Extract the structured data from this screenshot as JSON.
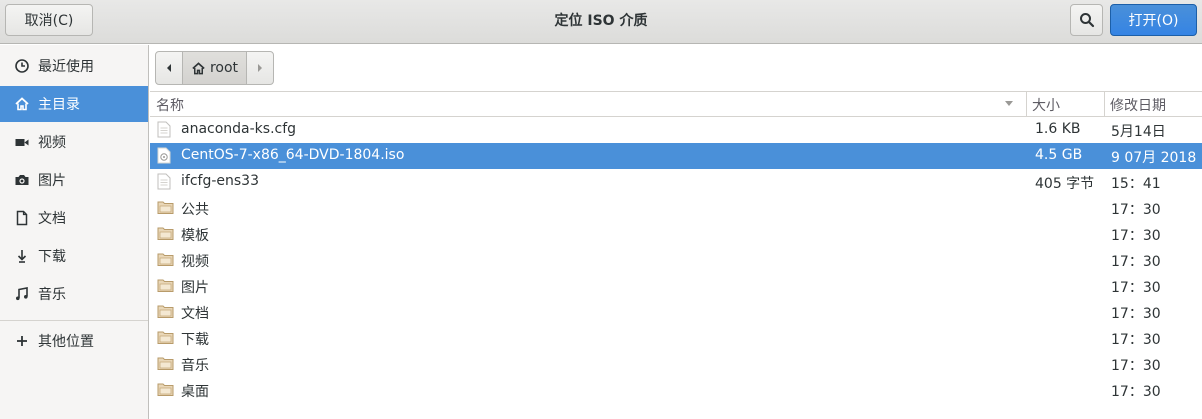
{
  "header": {
    "title": "定位  ISO 介质",
    "cancel_label": "取消(C)",
    "open_label": "打开(O)",
    "search_icon": "search-icon"
  },
  "sidebar": {
    "items": [
      {
        "label": "最近使用",
        "icon": "clock-icon"
      },
      {
        "label": "主目录",
        "icon": "home-icon",
        "active": true
      },
      {
        "label": "视频",
        "icon": "video-icon"
      },
      {
        "label": "图片",
        "icon": "camera-icon"
      },
      {
        "label": "文档",
        "icon": "document-icon"
      },
      {
        "label": "下载",
        "icon": "download-icon"
      },
      {
        "label": "音乐",
        "icon": "music-icon"
      },
      {
        "label": "其他位置",
        "icon": "plus-icon"
      }
    ]
  },
  "pathbar": {
    "crumb": "root"
  },
  "columns": {
    "name": "名称",
    "size": "大小",
    "modified": "修改日期"
  },
  "files": [
    {
      "name": "anaconda-ks.cfg",
      "size": "1.6 KB",
      "modified": "5月14日",
      "type": "file"
    },
    {
      "name": "CentOS-7-x86_64-DVD-1804.iso",
      "size": "4.5 GB",
      "modified": "9  07月  2018",
      "type": "disc",
      "selected": true
    },
    {
      "name": "ifcfg-ens33",
      "size": "405 字节",
      "modified": "15：41",
      "type": "file"
    },
    {
      "name": "公共",
      "size": "",
      "modified": "17：30",
      "type": "folder"
    },
    {
      "name": "模板",
      "size": "",
      "modified": "17：30",
      "type": "folder"
    },
    {
      "name": "视频",
      "size": "",
      "modified": "17：30",
      "type": "folder"
    },
    {
      "name": "图片",
      "size": "",
      "modified": "17：30",
      "type": "folder"
    },
    {
      "name": "文档",
      "size": "",
      "modified": "17：30",
      "type": "folder"
    },
    {
      "name": "下载",
      "size": "",
      "modified": "17：30",
      "type": "folder"
    },
    {
      "name": "音乐",
      "size": "",
      "modified": "17：30",
      "type": "folder"
    },
    {
      "name": "桌面",
      "size": "",
      "modified": "17：30",
      "type": "folder"
    }
  ],
  "colors": {
    "accent": "#4a90d9"
  }
}
